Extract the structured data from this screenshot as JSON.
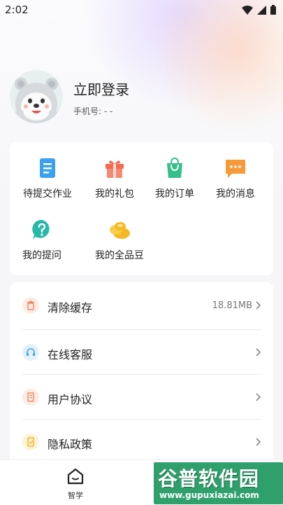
{
  "status_bar": {
    "time": "2:02"
  },
  "profile": {
    "login_text": "立即登录",
    "phone_label": "手机号: - -"
  },
  "quick_actions": [
    {
      "label": "待提交作业",
      "icon": "assignment-icon",
      "color": "#3aa0f0"
    },
    {
      "label": "我的礼包",
      "icon": "gift-icon",
      "color": "#f36b4f"
    },
    {
      "label": "我的订单",
      "icon": "shopping-bag-icon",
      "color": "#33c08a"
    },
    {
      "label": "我的消息",
      "icon": "message-icon",
      "color": "#f79a3a"
    },
    {
      "label": "我的提问",
      "icon": "question-icon",
      "color": "#27b8a8"
    },
    {
      "label": "我的全品豆",
      "icon": "coins-icon",
      "color": "#f4b824"
    }
  ],
  "settings": [
    {
      "label": "清除缓存",
      "value": "18.81MB",
      "icon": "trash-icon",
      "color": "#f08b63"
    },
    {
      "label": "在线客服",
      "value": "",
      "icon": "headset-icon",
      "color": "#3aa0f0"
    },
    {
      "label": "用户协议",
      "value": "",
      "icon": "document-icon",
      "color": "#f08b63"
    },
    {
      "label": "隐私政策",
      "value": "",
      "icon": "privacy-icon",
      "color": "#f4b824"
    }
  ],
  "tabbar": {
    "home_label": "智学"
  },
  "watermark": {
    "text": "谷普软件园",
    "url": "www.gupuxiazai.com"
  }
}
